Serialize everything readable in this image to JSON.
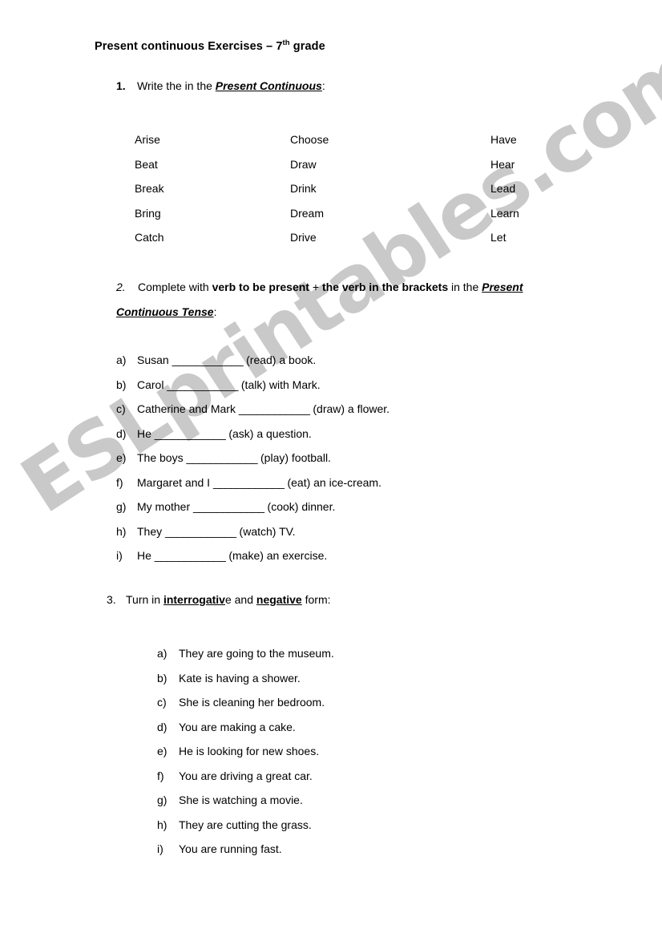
{
  "document": {
    "title_prefix": "Present continuous Exercises – 7",
    "title_sup": "th",
    "title_suffix": " grade"
  },
  "watermark": {
    "text": "ESLprintables.com",
    "color": "#c9c9c9"
  },
  "exercise1": {
    "number": "1.",
    "instruction_prefix": "Write the in the ",
    "instruction_emphasis": "Present Continuous",
    "instruction_suffix": ":",
    "verb_rows": [
      {
        "col1": "Arise",
        "col2": "Choose",
        "col3": "Have"
      },
      {
        "col1": "Beat",
        "col2": "Draw",
        "col3": "Hear"
      },
      {
        "col1": "Break",
        "col2": "Drink",
        "col3": "Lead"
      },
      {
        "col1": "Bring",
        "col2": "Dream",
        "col3": "Learn"
      },
      {
        "col1": "Catch",
        "col2": "Drive",
        "col3": "Let"
      }
    ]
  },
  "exercise2": {
    "number": "2.",
    "instruction_part1": "Complete with ",
    "instruction_bold1": "verb to be present",
    "instruction_part2": " + ",
    "instruction_bold2": "the verb in the brackets",
    "instruction_part3": " in the ",
    "instruction_emphasis1": "Present Continuous Tense",
    "instruction_suffix": ":",
    "items": [
      {
        "label": "a)",
        "before": "Susan ",
        "blank": "____________",
        "after": " (read) a book."
      },
      {
        "label": "b)",
        "before": "Carol ",
        "blank": "____________",
        "after": " (talk) with Mark."
      },
      {
        "label": "c)",
        "before": "Catherine and Mark ",
        "blank": "____________",
        "after": " (draw) a flower."
      },
      {
        "label": "d)",
        "before": "He ",
        "blank": "____________",
        "after": " (ask) a question."
      },
      {
        "label": "e)",
        "before": "The boys ",
        "blank": "____________",
        "after": " (play) football."
      },
      {
        "label": "f)",
        "before": "Margaret and I ",
        "blank": "____________",
        "after": " (eat) an ice-cream."
      },
      {
        "label": "g)",
        "before": "My mother ",
        "blank": "____________",
        "after": " (cook) dinner."
      },
      {
        "label": "h)",
        "before": "They ",
        "blank": "____________",
        "after": " (watch) TV."
      },
      {
        "label": "i)",
        "before": "He ",
        "blank": "____________",
        "after": " (make) an exercise."
      }
    ]
  },
  "exercise3": {
    "number": "3.",
    "instruction_part1": "Turn in ",
    "instruction_bold1": "interrogativ",
    "instruction_part2": "e and ",
    "instruction_bold2": "negative",
    "instruction_part3": " form:",
    "items": [
      {
        "label": "a)",
        "text": "They are going to the museum."
      },
      {
        "label": "b)",
        "text": "Kate is having a shower."
      },
      {
        "label": "c)",
        "text": "She is cleaning her bedroom."
      },
      {
        "label": "d)",
        "text": "You are making a cake."
      },
      {
        "label": "e)",
        "text": "He is looking for new shoes."
      },
      {
        "label": "f)",
        "text": "You are driving a great car."
      },
      {
        "label": "g)",
        "text": "She is watching a movie."
      },
      {
        "label": "h)",
        "text": "They are cutting the grass."
      },
      {
        "label": "i)",
        "text": "You are running fast."
      }
    ]
  }
}
